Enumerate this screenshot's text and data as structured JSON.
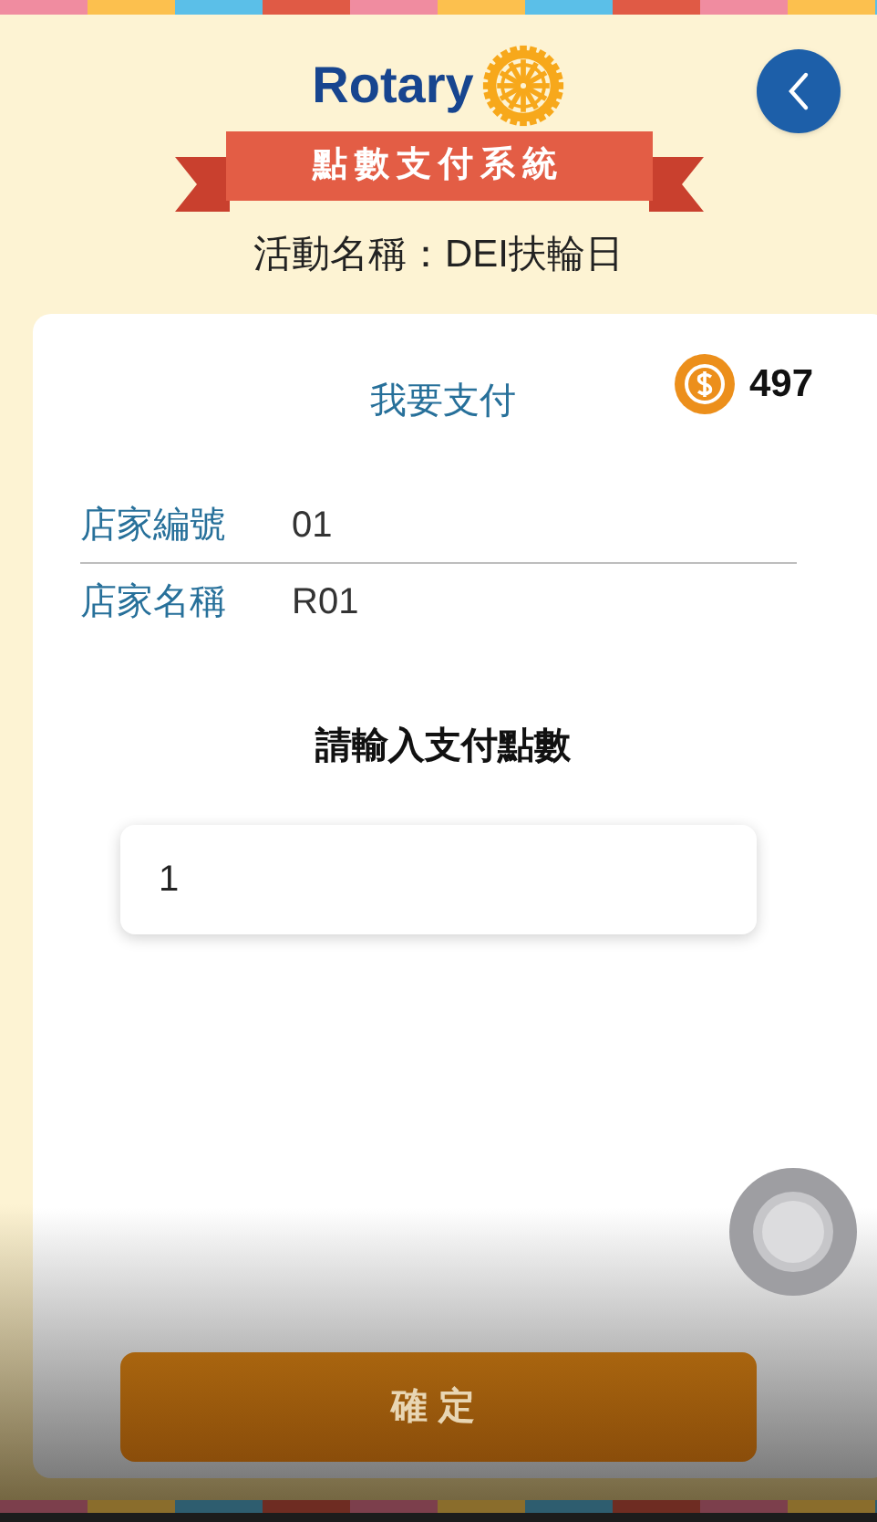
{
  "header": {
    "logo_text": "Rotary",
    "banner": "點數支付系統",
    "event": "活動名稱：DEI扶輪日"
  },
  "card": {
    "title": "我要支付",
    "balance": "497",
    "fields": [
      {
        "label": "店家編號",
        "value": "01"
      },
      {
        "label": "店家名稱",
        "value": "R01"
      }
    ],
    "prompt": "請輸入支付點數",
    "amount": "1",
    "confirm": "確定"
  }
}
